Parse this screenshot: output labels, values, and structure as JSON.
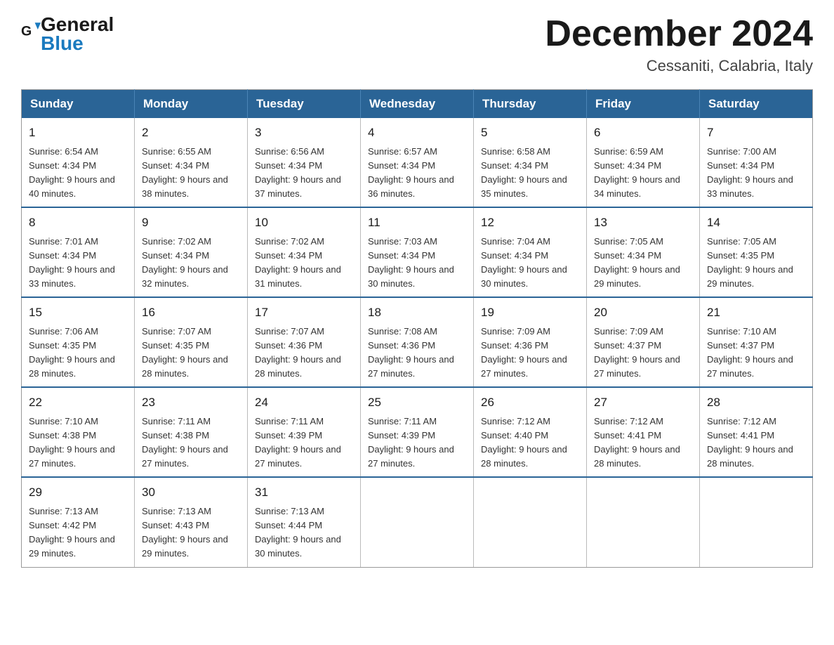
{
  "header": {
    "logo_general": "General",
    "logo_blue": "Blue",
    "month_title": "December 2024",
    "subtitle": "Cessaniti, Calabria, Italy"
  },
  "days_of_week": [
    "Sunday",
    "Monday",
    "Tuesday",
    "Wednesday",
    "Thursday",
    "Friday",
    "Saturday"
  ],
  "weeks": [
    [
      {
        "day": "1",
        "sunrise": "6:54 AM",
        "sunset": "4:34 PM",
        "daylight": "9 hours and 40 minutes."
      },
      {
        "day": "2",
        "sunrise": "6:55 AM",
        "sunset": "4:34 PM",
        "daylight": "9 hours and 38 minutes."
      },
      {
        "day": "3",
        "sunrise": "6:56 AM",
        "sunset": "4:34 PM",
        "daylight": "9 hours and 37 minutes."
      },
      {
        "day": "4",
        "sunrise": "6:57 AM",
        "sunset": "4:34 PM",
        "daylight": "9 hours and 36 minutes."
      },
      {
        "day": "5",
        "sunrise": "6:58 AM",
        "sunset": "4:34 PM",
        "daylight": "9 hours and 35 minutes."
      },
      {
        "day": "6",
        "sunrise": "6:59 AM",
        "sunset": "4:34 PM",
        "daylight": "9 hours and 34 minutes."
      },
      {
        "day": "7",
        "sunrise": "7:00 AM",
        "sunset": "4:34 PM",
        "daylight": "9 hours and 33 minutes."
      }
    ],
    [
      {
        "day": "8",
        "sunrise": "7:01 AM",
        "sunset": "4:34 PM",
        "daylight": "9 hours and 33 minutes."
      },
      {
        "day": "9",
        "sunrise": "7:02 AM",
        "sunset": "4:34 PM",
        "daylight": "9 hours and 32 minutes."
      },
      {
        "day": "10",
        "sunrise": "7:02 AM",
        "sunset": "4:34 PM",
        "daylight": "9 hours and 31 minutes."
      },
      {
        "day": "11",
        "sunrise": "7:03 AM",
        "sunset": "4:34 PM",
        "daylight": "9 hours and 30 minutes."
      },
      {
        "day": "12",
        "sunrise": "7:04 AM",
        "sunset": "4:34 PM",
        "daylight": "9 hours and 30 minutes."
      },
      {
        "day": "13",
        "sunrise": "7:05 AM",
        "sunset": "4:34 PM",
        "daylight": "9 hours and 29 minutes."
      },
      {
        "day": "14",
        "sunrise": "7:05 AM",
        "sunset": "4:35 PM",
        "daylight": "9 hours and 29 minutes."
      }
    ],
    [
      {
        "day": "15",
        "sunrise": "7:06 AM",
        "sunset": "4:35 PM",
        "daylight": "9 hours and 28 minutes."
      },
      {
        "day": "16",
        "sunrise": "7:07 AM",
        "sunset": "4:35 PM",
        "daylight": "9 hours and 28 minutes."
      },
      {
        "day": "17",
        "sunrise": "7:07 AM",
        "sunset": "4:36 PM",
        "daylight": "9 hours and 28 minutes."
      },
      {
        "day": "18",
        "sunrise": "7:08 AM",
        "sunset": "4:36 PM",
        "daylight": "9 hours and 27 minutes."
      },
      {
        "day": "19",
        "sunrise": "7:09 AM",
        "sunset": "4:36 PM",
        "daylight": "9 hours and 27 minutes."
      },
      {
        "day": "20",
        "sunrise": "7:09 AM",
        "sunset": "4:37 PM",
        "daylight": "9 hours and 27 minutes."
      },
      {
        "day": "21",
        "sunrise": "7:10 AM",
        "sunset": "4:37 PM",
        "daylight": "9 hours and 27 minutes."
      }
    ],
    [
      {
        "day": "22",
        "sunrise": "7:10 AM",
        "sunset": "4:38 PM",
        "daylight": "9 hours and 27 minutes."
      },
      {
        "day": "23",
        "sunrise": "7:11 AM",
        "sunset": "4:38 PM",
        "daylight": "9 hours and 27 minutes."
      },
      {
        "day": "24",
        "sunrise": "7:11 AM",
        "sunset": "4:39 PM",
        "daylight": "9 hours and 27 minutes."
      },
      {
        "day": "25",
        "sunrise": "7:11 AM",
        "sunset": "4:39 PM",
        "daylight": "9 hours and 27 minutes."
      },
      {
        "day": "26",
        "sunrise": "7:12 AM",
        "sunset": "4:40 PM",
        "daylight": "9 hours and 28 minutes."
      },
      {
        "day": "27",
        "sunrise": "7:12 AM",
        "sunset": "4:41 PM",
        "daylight": "9 hours and 28 minutes."
      },
      {
        "day": "28",
        "sunrise": "7:12 AM",
        "sunset": "4:41 PM",
        "daylight": "9 hours and 28 minutes."
      }
    ],
    [
      {
        "day": "29",
        "sunrise": "7:13 AM",
        "sunset": "4:42 PM",
        "daylight": "9 hours and 29 minutes."
      },
      {
        "day": "30",
        "sunrise": "7:13 AM",
        "sunset": "4:43 PM",
        "daylight": "9 hours and 29 minutes."
      },
      {
        "day": "31",
        "sunrise": "7:13 AM",
        "sunset": "4:44 PM",
        "daylight": "9 hours and 30 minutes."
      },
      null,
      null,
      null,
      null
    ]
  ],
  "labels": {
    "sunrise_prefix": "Sunrise: ",
    "sunset_prefix": "Sunset: ",
    "daylight_prefix": "Daylight: "
  }
}
